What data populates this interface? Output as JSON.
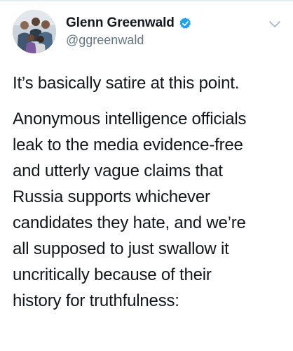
{
  "tweet": {
    "author": {
      "display_name": "Glenn Greenwald",
      "handle": "@ggreenwald",
      "verified": true
    },
    "paragraphs": [
      "It’s basically satire at this point.",
      "Anonymous intelligence officials\nleak to the media evidence-free\nand utterly vague claims that\nRussia supports whichever\ncandidates they hate, and we’re\nall supposed to just swallow it\nuncritically because of their\nhistory for truthfulness:"
    ]
  },
  "icons": {
    "verified": "verified-badge-icon",
    "menu": "chevron-down-icon"
  },
  "colors": {
    "text": "#14171a",
    "secondary_text": "#657786",
    "verified_blue": "#1da1f2",
    "chevron": "#aab8c2"
  }
}
